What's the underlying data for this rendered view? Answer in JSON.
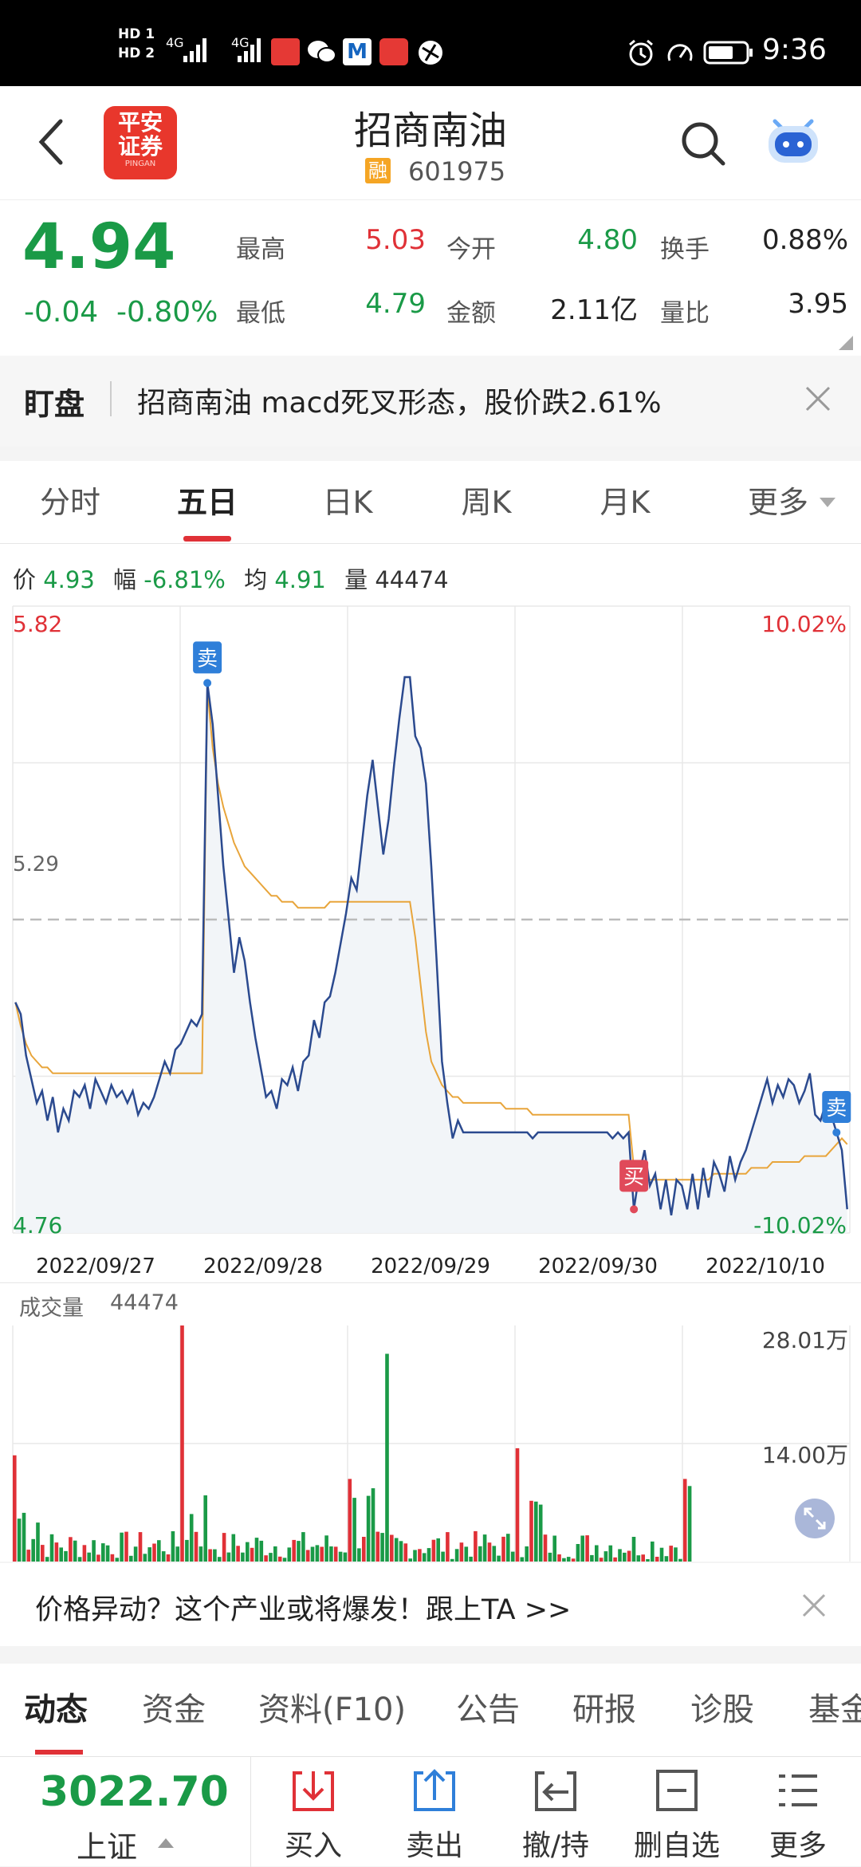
{
  "status_bar": {
    "network_badges": [
      "HD 1",
      "HD 2",
      "4G",
      "4G"
    ],
    "time": "9:36"
  },
  "header": {
    "app_logo_text": [
      "平安",
      "证券"
    ],
    "app_logo_sub": "PINGAN",
    "stock_name": "招商南油",
    "margin_badge": "融",
    "stock_code": "601975"
  },
  "quote": {
    "price": "4.94",
    "change": "-0.04",
    "change_pct": "-0.80%",
    "high_label": "最高",
    "high": "5.03",
    "open_label": "今开",
    "open": "4.80",
    "turnover_label": "换手",
    "turnover": "0.88%",
    "low_label": "最低",
    "low": "4.79",
    "amount_label": "金额",
    "amount": "2.11亿",
    "vol_ratio_label": "量比",
    "vol_ratio": "3.95"
  },
  "watch": {
    "label": "盯盘",
    "message": "招商南油 macd死叉形态，股价跌2.61%"
  },
  "tabs": [
    "分时",
    "五日",
    "日K",
    "周K",
    "月K",
    "更多"
  ],
  "active_tab": "五日",
  "chart_info": {
    "price_label": "价",
    "price": "4.93",
    "amp_label": "幅",
    "amp": "-6.81%",
    "avg_label": "均",
    "avg": "4.91",
    "vol_label": "量",
    "vol": "44474"
  },
  "chart_data": {
    "type": "line",
    "y_max_label": "5.82",
    "y_min_label": "4.76",
    "y_ref_label": "5.29",
    "pct_max_label": "10.02%",
    "pct_min_label": "-10.02%",
    "ylim": [
      4.76,
      5.82
    ],
    "reference": 5.29,
    "dates": [
      "2022/09/27",
      "2022/09/28",
      "2022/09/29",
      "2022/09/30",
      "2022/10/10"
    ],
    "series": [
      {
        "values": [
          5.15,
          5.13,
          5.06,
          5.02,
          4.98,
          5.0,
          4.95,
          4.99,
          4.93,
          4.97,
          4.95,
          5.0,
          4.99,
          5.01,
          4.97,
          5.02,
          5.0,
          4.98,
          5.01,
          4.99,
          5.0,
          4.98,
          5.0,
          4.96,
          4.98,
          4.97,
          4.99,
          5.02,
          5.05,
          5.03,
          5.07,
          5.08,
          5.1,
          5.12,
          5.11,
          5.13,
          5.69,
          5.62,
          5.5,
          5.38,
          5.29,
          5.2,
          5.26,
          5.22,
          5.15,
          5.09,
          5.04,
          4.99,
          5.0,
          4.97,
          5.02,
          5.01,
          5.04,
          5.0,
          5.05,
          5.06,
          5.12,
          5.09,
          5.15,
          5.16,
          5.2,
          5.25,
          5.3,
          5.36,
          5.34,
          5.42,
          5.5,
          5.56,
          5.48,
          5.4,
          5.46,
          5.55,
          5.63,
          5.7,
          5.7,
          5.6,
          5.58,
          5.52,
          5.38,
          5.22,
          5.05,
          4.98,
          4.92,
          4.95,
          4.93,
          4.93,
          4.93,
          4.93,
          4.93,
          4.93,
          4.93,
          4.93,
          4.93,
          4.93,
          4.93,
          4.93,
          4.93,
          4.92,
          4.93,
          4.93,
          4.93,
          4.93,
          4.93,
          4.93,
          4.93,
          4.93,
          4.93,
          4.93,
          4.93,
          4.93,
          4.93,
          4.93,
          4.92,
          4.93,
          4.92,
          4.93,
          4.8,
          4.86,
          4.9,
          4.84,
          4.86,
          4.8,
          4.85,
          4.79,
          4.85,
          4.84,
          4.8,
          4.86,
          4.8,
          4.87,
          4.82,
          4.88,
          4.86,
          4.83,
          4.89,
          4.85,
          4.88,
          4.9,
          4.93,
          4.96,
          4.99,
          5.02,
          4.98,
          5.01,
          4.99,
          5.02,
          5.01,
          4.98,
          5.0,
          5.03,
          4.96,
          4.95,
          4.98,
          4.96,
          4.93,
          4.9,
          4.8
        ]
      },
      {
        "values": [
          5.15,
          5.11,
          5.08,
          5.06,
          5.05,
          5.04,
          5.04,
          5.03,
          5.03,
          5.03,
          5.03,
          5.03,
          5.03,
          5.03,
          5.03,
          5.03,
          5.03,
          5.03,
          5.03,
          5.03,
          5.03,
          5.03,
          5.03,
          5.03,
          5.03,
          5.03,
          5.03,
          5.03,
          5.03,
          5.03,
          5.03,
          5.03,
          5.03,
          5.03,
          5.03,
          5.03,
          5.68,
          5.58,
          5.52,
          5.48,
          5.45,
          5.42,
          5.4,
          5.38,
          5.37,
          5.36,
          5.35,
          5.34,
          5.33,
          5.33,
          5.32,
          5.32,
          5.32,
          5.31,
          5.31,
          5.31,
          5.31,
          5.31,
          5.31,
          5.32,
          5.32,
          5.32,
          5.32,
          5.32,
          5.32,
          5.32,
          5.32,
          5.32,
          5.32,
          5.32,
          5.32,
          5.32,
          5.32,
          5.32,
          5.32,
          5.26,
          5.18,
          5.1,
          5.05,
          5.03,
          5.01,
          5.0,
          4.99,
          4.99,
          4.98,
          4.98,
          4.98,
          4.98,
          4.98,
          4.98,
          4.98,
          4.98,
          4.97,
          4.97,
          4.97,
          4.97,
          4.97,
          4.96,
          4.96,
          4.96,
          4.96,
          4.96,
          4.96,
          4.96,
          4.96,
          4.96,
          4.96,
          4.96,
          4.96,
          4.96,
          4.96,
          4.96,
          4.96,
          4.96,
          4.96,
          4.96,
          4.87,
          4.86,
          4.86,
          4.85,
          4.85,
          4.85,
          4.85,
          4.85,
          4.85,
          4.85,
          4.85,
          4.85,
          4.85,
          4.85,
          4.85,
          4.86,
          4.86,
          4.86,
          4.86,
          4.86,
          4.86,
          4.86,
          4.87,
          4.87,
          4.87,
          4.87,
          4.88,
          4.88,
          4.88,
          4.88,
          4.88,
          4.88,
          4.89,
          4.89,
          4.89,
          4.89,
          4.89,
          4.9,
          4.91,
          4.92,
          4.91
        ]
      }
    ],
    "colors": {
      "price": "#2b4a8f",
      "avg": "#e8a53b",
      "fill": "#f2f5f8",
      "ref": "#bbbbbb",
      "up": "#e03137",
      "down": "#1a9a47"
    },
    "markers": [
      {
        "label": "卖",
        "index": 36,
        "kind": "sell"
      },
      {
        "label": "买",
        "index": 116,
        "kind": "buy"
      },
      {
        "label": "卖",
        "index": 154,
        "kind": "sell"
      }
    ],
    "grid": true
  },
  "volume": {
    "label": "成交量",
    "value": "44474",
    "scale_top": "28.01万",
    "scale_mid": "14.00万",
    "max": 28.01,
    "bars_per_day": 36
  },
  "ad": {
    "text": "价格异动？这个产业或将爆发！跟上TA >>"
  },
  "info_tabs": [
    "动态",
    "资金",
    "资料(F10)",
    "公告",
    "研报",
    "诊股",
    "基金"
  ],
  "bottom": {
    "index_value": "3022.70",
    "index_name": "上证",
    "buttons": [
      "买入",
      "卖出",
      "撤/持",
      "删自选",
      "更多"
    ]
  }
}
